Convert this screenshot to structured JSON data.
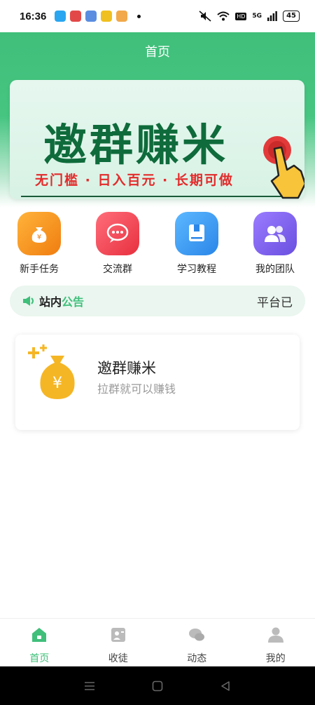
{
  "status_bar": {
    "time": "16:36",
    "battery": "45",
    "network": "5G",
    "hd": "HD"
  },
  "header": {
    "title": "首页"
  },
  "banner": {
    "title": "邀群赚米",
    "subtitle": "无门槛 · 日入百元 · 长期可做"
  },
  "menu": {
    "items": [
      {
        "label": "新手任务",
        "color": "#f59a1b"
      },
      {
        "label": "交流群",
        "color": "#f04a5a"
      },
      {
        "label": "学习教程",
        "color": "#3a9cf0"
      },
      {
        "label": "我的团队",
        "color": "#7b63e6"
      }
    ]
  },
  "notice": {
    "title_part1": "站内",
    "title_part2": "公告",
    "text": "平台已"
  },
  "card": {
    "title": "邀群赚米",
    "description": "拉群就可以赚钱"
  },
  "tabbar": {
    "items": [
      {
        "label": "首页",
        "icon": "home-icon",
        "active": true
      },
      {
        "label": "收徒",
        "icon": "apprentice-icon",
        "active": false
      },
      {
        "label": "动态",
        "icon": "chat-bubble-icon",
        "active": false
      },
      {
        "label": "我的",
        "icon": "user-icon",
        "active": false
      }
    ]
  },
  "colors": {
    "brand_green": "#3fbf7a",
    "banner_text": "#0f6b3b",
    "banner_subtitle": "#e32b2b"
  }
}
